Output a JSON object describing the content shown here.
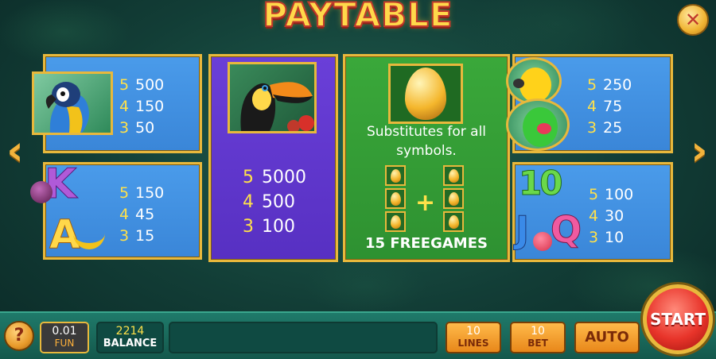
{
  "title": "PAYTABLE",
  "close_label": "✕",
  "nav": {
    "prev": "‹",
    "next": "›"
  },
  "parrot_blue": {
    "pays": [
      {
        "n": "5",
        "v": "500"
      },
      {
        "n": "4",
        "v": "150"
      },
      {
        "n": "3",
        "v": "50"
      }
    ]
  },
  "letters_ka": {
    "pays": [
      {
        "n": "5",
        "v": "150"
      },
      {
        "n": "4",
        "v": "45"
      },
      {
        "n": "3",
        "v": "15"
      }
    ]
  },
  "toucan": {
    "pays": [
      {
        "n": "5",
        "v": "5000"
      },
      {
        "n": "4",
        "v": "500"
      },
      {
        "n": "3",
        "v": "100"
      }
    ]
  },
  "wild": {
    "text": "Substitutes for all symbols.",
    "free_text": "15 FREEGAMES",
    "plus": "+"
  },
  "parrots_small": {
    "pays": [
      {
        "n": "5",
        "v": "250"
      },
      {
        "n": "4",
        "v": "75"
      },
      {
        "n": "3",
        "v": "25"
      }
    ]
  },
  "letters_10jq": {
    "pays": [
      {
        "n": "5",
        "v": "100"
      },
      {
        "n": "4",
        "v": "30"
      },
      {
        "n": "3",
        "v": "10"
      }
    ]
  },
  "symbol_letters": {
    "k": "K",
    "a": "A",
    "ten": "10",
    "j": "J",
    "q": "Q"
  },
  "bottom": {
    "help": "?",
    "fun_value": "0.01",
    "fun_label": "FUN",
    "balance_value": "2214",
    "balance_label": "BALANCE",
    "lines_value": "10",
    "lines_label": "LINES",
    "bet_value": "10",
    "bet_label": "BET",
    "auto_label": "AUTO",
    "start_label": "START"
  }
}
